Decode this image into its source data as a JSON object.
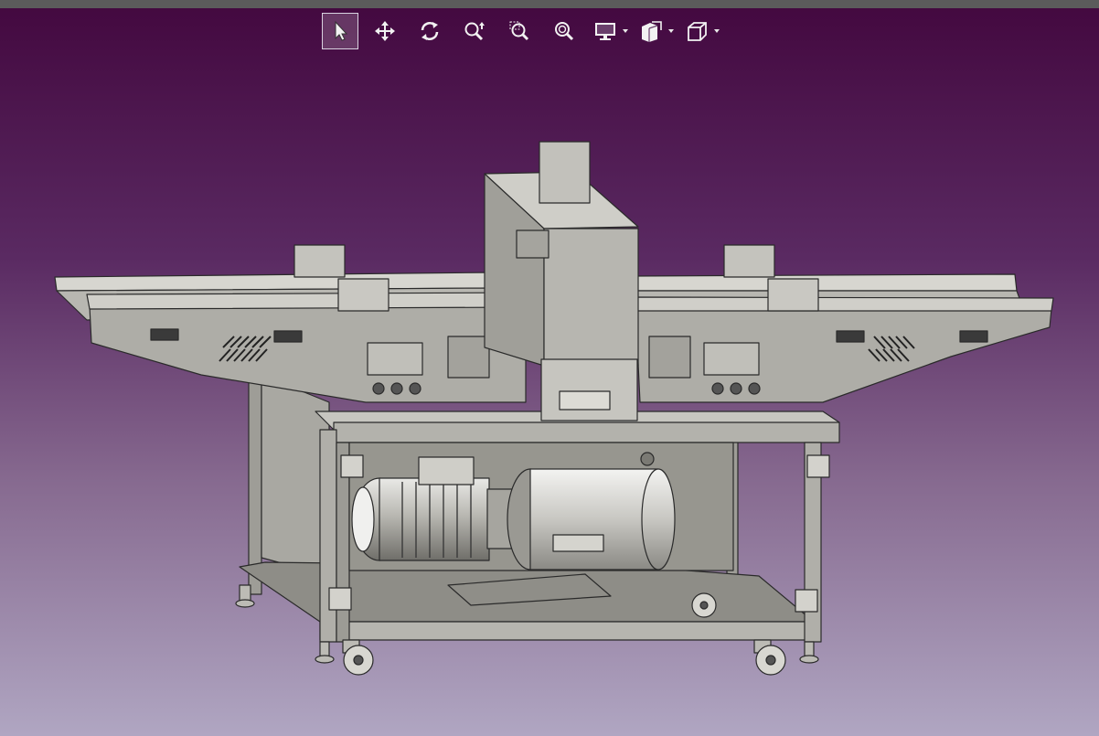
{
  "window": {
    "title_bar_color": "#5b5b5b"
  },
  "background": {
    "gradient_top": "#43083f",
    "gradient_bottom": "#b0a6c2"
  },
  "toolbar": {
    "buttons": [
      {
        "id": "select",
        "icon": "cursor-arrow-icon",
        "active": true
      },
      {
        "id": "pan",
        "icon": "move-arrows-icon",
        "active": false
      },
      {
        "id": "rotate",
        "icon": "rotate-icon",
        "active": false
      },
      {
        "id": "zoom-dynamic",
        "icon": "zoom-dynamic-icon",
        "active": false
      },
      {
        "id": "zoom-area",
        "icon": "zoom-area-icon",
        "active": false
      },
      {
        "id": "zoom-fit",
        "icon": "zoom-fit-icon",
        "active": false
      },
      {
        "id": "display-mode",
        "icon": "monitor-icon",
        "has_dropdown": true
      },
      {
        "id": "section",
        "icon": "section-box-icon",
        "has_dropdown": true
      },
      {
        "id": "view-cube",
        "icon": "cube-view-icon",
        "has_dropdown": true
      }
    ]
  },
  "viewport": {
    "model": "machine-assembly-3d-view",
    "model_colors": {
      "steel": "#a8a7a1",
      "steel_dark": "#7c7b75",
      "steel_light": "#c9c8c2",
      "outline": "#2a2a2a"
    }
  }
}
